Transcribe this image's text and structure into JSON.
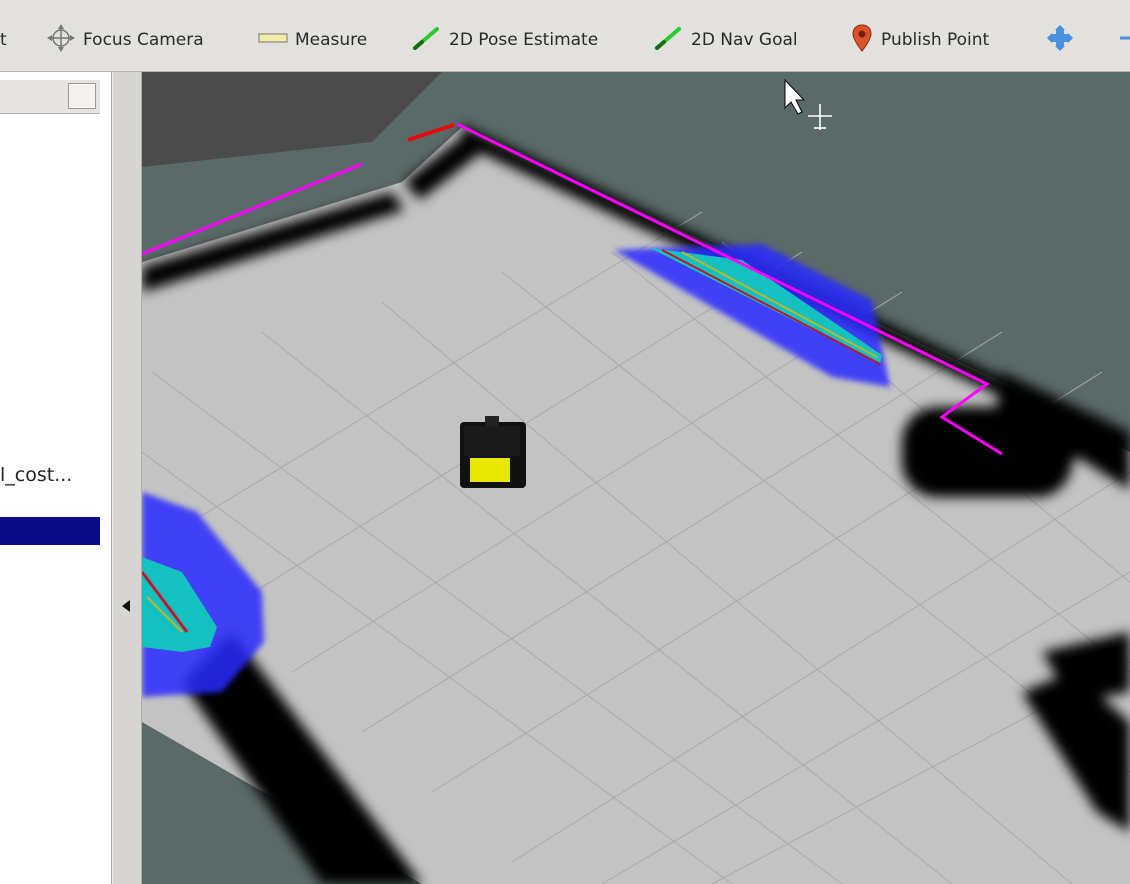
{
  "toolbar": {
    "partial_left": "t",
    "focus_camera": "Focus Camera",
    "measure": "Measure",
    "pose_estimate": "2D Pose Estimate",
    "nav_goal": "2D Nav Goal",
    "publish_point": "Publish Point"
  },
  "left_panel": {
    "item_partial": "l_cost..."
  },
  "colors": {
    "laser_scan": "#ff00ff",
    "obstacle": "#000000",
    "inflation_outer": "#2a2aff",
    "inflation_inner": "#14c0c0",
    "lethal": "#e01010",
    "footprint": "#e6e600"
  }
}
